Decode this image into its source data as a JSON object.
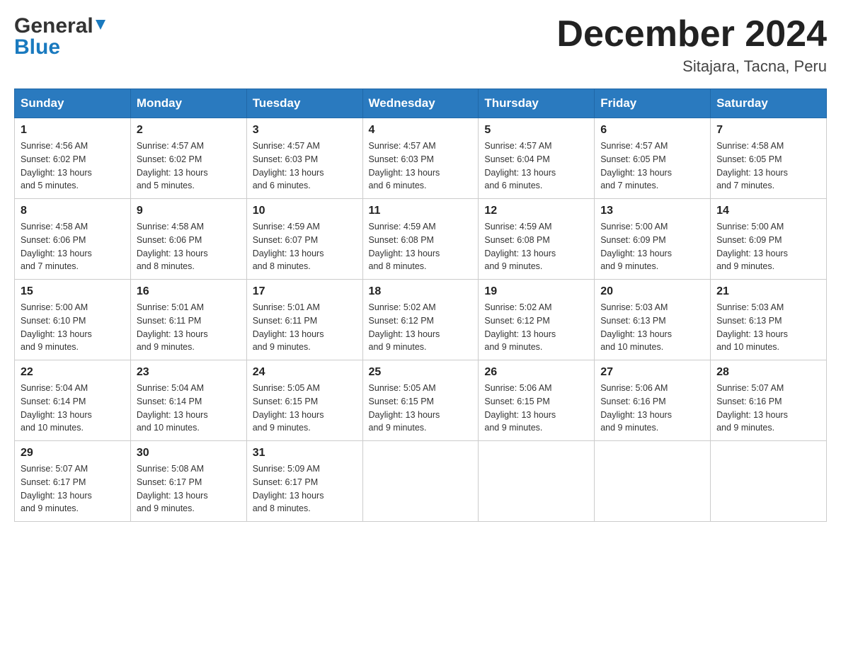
{
  "header": {
    "logo_general": "General",
    "logo_blue": "Blue",
    "title": "December 2024",
    "subtitle": "Sitajara, Tacna, Peru"
  },
  "weekdays": [
    "Sunday",
    "Monday",
    "Tuesday",
    "Wednesday",
    "Thursday",
    "Friday",
    "Saturday"
  ],
  "weeks": [
    [
      {
        "day": "1",
        "sunrise": "4:56 AM",
        "sunset": "6:02 PM",
        "daylight": "13 hours and 5 minutes."
      },
      {
        "day": "2",
        "sunrise": "4:57 AM",
        "sunset": "6:02 PM",
        "daylight": "13 hours and 5 minutes."
      },
      {
        "day": "3",
        "sunrise": "4:57 AM",
        "sunset": "6:03 PM",
        "daylight": "13 hours and 6 minutes."
      },
      {
        "day": "4",
        "sunrise": "4:57 AM",
        "sunset": "6:03 PM",
        "daylight": "13 hours and 6 minutes."
      },
      {
        "day": "5",
        "sunrise": "4:57 AM",
        "sunset": "6:04 PM",
        "daylight": "13 hours and 6 minutes."
      },
      {
        "day": "6",
        "sunrise": "4:57 AM",
        "sunset": "6:05 PM",
        "daylight": "13 hours and 7 minutes."
      },
      {
        "day": "7",
        "sunrise": "4:58 AM",
        "sunset": "6:05 PM",
        "daylight": "13 hours and 7 minutes."
      }
    ],
    [
      {
        "day": "8",
        "sunrise": "4:58 AM",
        "sunset": "6:06 PM",
        "daylight": "13 hours and 7 minutes."
      },
      {
        "day": "9",
        "sunrise": "4:58 AM",
        "sunset": "6:06 PM",
        "daylight": "13 hours and 8 minutes."
      },
      {
        "day": "10",
        "sunrise": "4:59 AM",
        "sunset": "6:07 PM",
        "daylight": "13 hours and 8 minutes."
      },
      {
        "day": "11",
        "sunrise": "4:59 AM",
        "sunset": "6:08 PM",
        "daylight": "13 hours and 8 minutes."
      },
      {
        "day": "12",
        "sunrise": "4:59 AM",
        "sunset": "6:08 PM",
        "daylight": "13 hours and 9 minutes."
      },
      {
        "day": "13",
        "sunrise": "5:00 AM",
        "sunset": "6:09 PM",
        "daylight": "13 hours and 9 minutes."
      },
      {
        "day": "14",
        "sunrise": "5:00 AM",
        "sunset": "6:09 PM",
        "daylight": "13 hours and 9 minutes."
      }
    ],
    [
      {
        "day": "15",
        "sunrise": "5:00 AM",
        "sunset": "6:10 PM",
        "daylight": "13 hours and 9 minutes."
      },
      {
        "day": "16",
        "sunrise": "5:01 AM",
        "sunset": "6:11 PM",
        "daylight": "13 hours and 9 minutes."
      },
      {
        "day": "17",
        "sunrise": "5:01 AM",
        "sunset": "6:11 PM",
        "daylight": "13 hours and 9 minutes."
      },
      {
        "day": "18",
        "sunrise": "5:02 AM",
        "sunset": "6:12 PM",
        "daylight": "13 hours and 9 minutes."
      },
      {
        "day": "19",
        "sunrise": "5:02 AM",
        "sunset": "6:12 PM",
        "daylight": "13 hours and 9 minutes."
      },
      {
        "day": "20",
        "sunrise": "5:03 AM",
        "sunset": "6:13 PM",
        "daylight": "13 hours and 10 minutes."
      },
      {
        "day": "21",
        "sunrise": "5:03 AM",
        "sunset": "6:13 PM",
        "daylight": "13 hours and 10 minutes."
      }
    ],
    [
      {
        "day": "22",
        "sunrise": "5:04 AM",
        "sunset": "6:14 PM",
        "daylight": "13 hours and 10 minutes."
      },
      {
        "day": "23",
        "sunrise": "5:04 AM",
        "sunset": "6:14 PM",
        "daylight": "13 hours and 10 minutes."
      },
      {
        "day": "24",
        "sunrise": "5:05 AM",
        "sunset": "6:15 PM",
        "daylight": "13 hours and 9 minutes."
      },
      {
        "day": "25",
        "sunrise": "5:05 AM",
        "sunset": "6:15 PM",
        "daylight": "13 hours and 9 minutes."
      },
      {
        "day": "26",
        "sunrise": "5:06 AM",
        "sunset": "6:15 PM",
        "daylight": "13 hours and 9 minutes."
      },
      {
        "day": "27",
        "sunrise": "5:06 AM",
        "sunset": "6:16 PM",
        "daylight": "13 hours and 9 minutes."
      },
      {
        "day": "28",
        "sunrise": "5:07 AM",
        "sunset": "6:16 PM",
        "daylight": "13 hours and 9 minutes."
      }
    ],
    [
      {
        "day": "29",
        "sunrise": "5:07 AM",
        "sunset": "6:17 PM",
        "daylight": "13 hours and 9 minutes."
      },
      {
        "day": "30",
        "sunrise": "5:08 AM",
        "sunset": "6:17 PM",
        "daylight": "13 hours and 9 minutes."
      },
      {
        "day": "31",
        "sunrise": "5:09 AM",
        "sunset": "6:17 PM",
        "daylight": "13 hours and 8 minutes."
      },
      null,
      null,
      null,
      null
    ]
  ],
  "labels": {
    "sunrise": "Sunrise:",
    "sunset": "Sunset:",
    "daylight": "Daylight:"
  }
}
